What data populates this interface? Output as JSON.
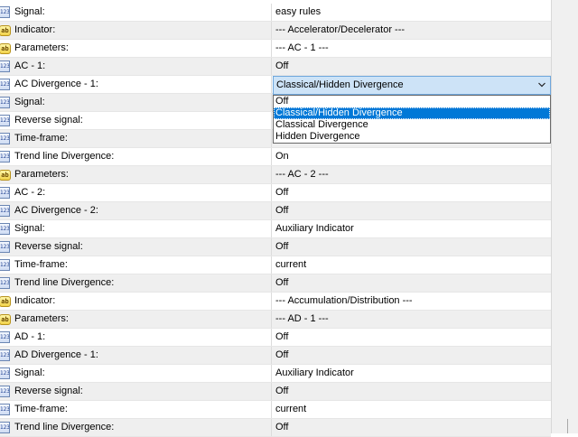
{
  "rows": [
    {
      "name": "Signal:",
      "value": "easy rules",
      "icon": "numeric-param-icon"
    },
    {
      "name": "Indicator:",
      "value": "--- Accelerator/Decelerator ---",
      "icon": "string-param-icon"
    },
    {
      "name": "Parameters:",
      "value": "--- AC - 1 ---",
      "icon": "string-param-icon"
    },
    {
      "name": "AC - 1:",
      "value": "Off",
      "icon": "numeric-param-icon"
    },
    {
      "name": "AC Divergence - 1:",
      "value": "",
      "icon": "numeric-param-icon"
    },
    {
      "name": "Signal:",
      "value": "",
      "icon": "numeric-param-icon"
    },
    {
      "name": "Reverse signal:",
      "value": "",
      "icon": "numeric-param-icon"
    },
    {
      "name": "Time-frame:",
      "value": "",
      "icon": "numeric-param-icon"
    },
    {
      "name": "Trend line Divergence:",
      "value": "On",
      "icon": "numeric-param-icon"
    },
    {
      "name": "Parameters:",
      "value": "--- AC - 2 ---",
      "icon": "string-param-icon"
    },
    {
      "name": "AC - 2:",
      "value": "Off",
      "icon": "numeric-param-icon"
    },
    {
      "name": "AC Divergence - 2:",
      "value": "Off",
      "icon": "numeric-param-icon"
    },
    {
      "name": "Signal:",
      "value": "Auxiliary Indicator",
      "icon": "numeric-param-icon"
    },
    {
      "name": "Reverse signal:",
      "value": "Off",
      "icon": "numeric-param-icon"
    },
    {
      "name": "Time-frame:",
      "value": "current",
      "icon": "numeric-param-icon"
    },
    {
      "name": "Trend line Divergence:",
      "value": "Off",
      "icon": "numeric-param-icon"
    },
    {
      "name": "Indicator:",
      "value": "--- Accumulation/Distribution ---",
      "icon": "string-param-icon"
    },
    {
      "name": "Parameters:",
      "value": "--- AD - 1 ---",
      "icon": "string-param-icon"
    },
    {
      "name": "AD - 1:",
      "value": "Off",
      "icon": "numeric-param-icon"
    },
    {
      "name": "AD Divergence - 1:",
      "value": "Off",
      "icon": "numeric-param-icon"
    },
    {
      "name": "Signal:",
      "value": "Auxiliary Indicator",
      "icon": "numeric-param-icon"
    },
    {
      "name": "Reverse signal:",
      "value": "Off",
      "icon": "numeric-param-icon"
    },
    {
      "name": "Time-frame:",
      "value": "current",
      "icon": "numeric-param-icon"
    },
    {
      "name": "Trend line Divergence:",
      "value": "Off",
      "icon": "numeric-param-icon"
    }
  ],
  "icon_labels": {
    "numeric": "123",
    "string": "ab"
  },
  "combo": {
    "selected_value": "Classical/Hidden Divergence",
    "options": [
      "Off",
      "Classical/Hidden Divergence",
      "Classical Divergence",
      "Hidden Divergence"
    ],
    "highlighted_index": 1
  },
  "colors": {
    "highlight": "#0078d7",
    "combo_bg": "#cde3f7",
    "alt_row": "#efefef"
  }
}
